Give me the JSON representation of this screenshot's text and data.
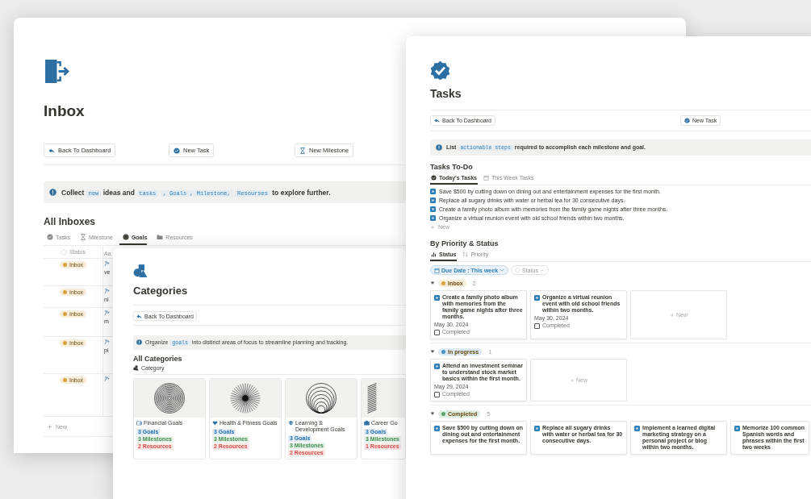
{
  "inbox_window": {
    "title": "Inbox",
    "buttons": [
      {
        "label": "Back To Dashboard"
      },
      {
        "label": "New Task"
      },
      {
        "label": "New Milestone"
      }
    ],
    "callout": [
      {
        "text": "Collect",
        "kind": "text"
      },
      {
        "text": "new",
        "kind": "code"
      },
      {
        "text": "ideas and",
        "kind": "text"
      },
      {
        "text": "tasks",
        "kind": "code"
      },
      {
        "text": ", Goals , Milestone,",
        "kind": "code"
      },
      {
        "text": "Resourses",
        "kind": "code"
      },
      {
        "text": "to explore further.",
        "kind": "text"
      }
    ],
    "section_title": "All Inboxes",
    "tabs": [
      {
        "label": "Tasks",
        "selected": false
      },
      {
        "label": "Milestone",
        "selected": false
      },
      {
        "label": "Goals",
        "selected": true
      },
      {
        "label": "Resources",
        "selected": false
      }
    ],
    "table": {
      "columns": [
        "Status",
        "Aa"
      ],
      "rows": [
        {
          "status": "Inbox",
          "color": "#d9a33c",
          "column_2": "ve"
        },
        {
          "status": "Inbox",
          "color": "#d9a33c",
          "column_2": "ni"
        },
        {
          "status": "Inbox",
          "color": "#d9a33c",
          "column_2": "m"
        },
        {
          "status": "Inbox",
          "color": "#d9a33c",
          "column_2": "pi"
        },
        {
          "status": "Inbox",
          "color": "#d9a33c"
        }
      ]
    },
    "new_row": "New"
  },
  "categories_window": {
    "title": "Categories",
    "buttons": [
      {
        "label": "Back To Dashboard"
      }
    ],
    "callout": [
      {
        "text": "Organize",
        "kind": "text"
      },
      {
        "text": "goals",
        "kind": "code"
      },
      {
        "text": "into distinct areas of focus to streamline planning and tracking.",
        "kind": "text"
      }
    ],
    "section_title": "All Categories",
    "tabs": [
      {
        "label": "Category",
        "selected": true
      }
    ],
    "cards": [
      {
        "title": "Financial Goals",
        "tags": [
          {
            "label": "3 Goals",
            "color": "#1f6fb2"
          },
          {
            "label": "3 Milestones",
            "color": "#3f8f4f"
          },
          {
            "label": "2 Resources",
            "color": "#d44c47"
          }
        ]
      },
      {
        "title": "Health & Fitness Goals",
        "tags": [
          {
            "label": "3 Goals",
            "color": "#1f6fb2"
          },
          {
            "label": "3 Milestones",
            "color": "#3f8f4f"
          },
          {
            "label": "2 Resources",
            "color": "#d44c47"
          }
        ]
      },
      {
        "title": "Learning & Development Goals",
        "tags": [
          {
            "label": "3 Goals",
            "color": "#1f6fb2"
          },
          {
            "label": "3 Milestones",
            "color": "#3f8f4f"
          },
          {
            "label": "2 Resources",
            "color": "#d44c47"
          }
        ]
      },
      {
        "title": "Career Go",
        "tags": [
          {
            "label": "3 Goals",
            "color": "#1f6fb2"
          },
          {
            "label": "3 Milestones",
            "color": "#3f8f4f"
          },
          {
            "label": "1 Resources",
            "color": "#d44c47"
          }
        ]
      }
    ]
  },
  "tasks_window": {
    "title": "Tasks",
    "buttons": [
      {
        "label": "Back To Dashboard"
      },
      {
        "label": "New Task"
      }
    ],
    "callout": [
      {
        "text": "List",
        "kind": "text"
      },
      {
        "text": "actionable steps",
        "kind": "code"
      },
      {
        "text": "required to accomplish each milestone and goal.",
        "kind": "text"
      }
    ],
    "todo": {
      "title": "Tasks To-Do",
      "tabs": [
        {
          "label": "Today's Tasks",
          "selected": true
        },
        {
          "label": "This Week Tasks",
          "selected": false
        }
      ],
      "items": [
        {
          "text": "Save $500 by cutting down on dining out and entertainment expenses for the first month.",
          "checked": true
        },
        {
          "text": "Replace all sugary drinks with water or herbal tea for 30 consecutive days.",
          "checked": true
        },
        {
          "text": "Create a family photo album with memories from the family game nights after three months.",
          "checked": true
        },
        {
          "text": "Organize a virtual reunion event with old school friends within two months.",
          "checked": true
        }
      ],
      "new_row": "New"
    },
    "board": {
      "title": "By Priority & Status",
      "tabs": [
        {
          "label": "Status",
          "selected": true
        },
        {
          "label": "Priority",
          "selected": false
        }
      ],
      "filters": [
        {
          "label": "Due Date : This week",
          "active": true
        },
        {
          "label": "Status",
          "active": false
        }
      ],
      "groups": [
        {
          "status": "Inbox",
          "color": "#d9a33c",
          "count": "2",
          "expanded": true,
          "new_card": "New",
          "cards": [
            {
              "title": "Create a family photo album with memories from the family game nights after three months.",
              "checked": true,
              "date": "May 30, 2024",
              "completed_label": "Completed",
              "completed": false
            },
            {
              "title": "Organize a virtual reunion event with old school friends within two months.",
              "checked": true,
              "date": "May 30, 2024",
              "completed_label": "Completed",
              "completed": false
            }
          ]
        },
        {
          "status": "In progress",
          "color": "#4a8fc4",
          "count": "1",
          "expanded": true,
          "new_card": "New",
          "cards": [
            {
              "title": "Attend an investment seminar to understand stock market basics within the first month.",
              "checked": true,
              "date": "May 29, 2024",
              "completed_label": "Completed",
              "completed": false
            }
          ]
        },
        {
          "status": "Completed",
          "color": "#5aa36a",
          "count": "5",
          "expanded": true,
          "cards": [
            {
              "title": "Save $500 by cutting down on dining out and entertainment expenses for the first month.",
              "checked": true
            },
            {
              "title": "Replace all sugary drinks with water or herbal tea for 30 consecutive days.",
              "checked": true
            },
            {
              "title": "Implement a learned digital marketing strategy on a personal project or blog within two months.",
              "checked": true
            },
            {
              "title": "Memorize 100 common Spanish words and phrases within the first two weeks",
              "checked": true
            }
          ]
        }
      ]
    }
  }
}
